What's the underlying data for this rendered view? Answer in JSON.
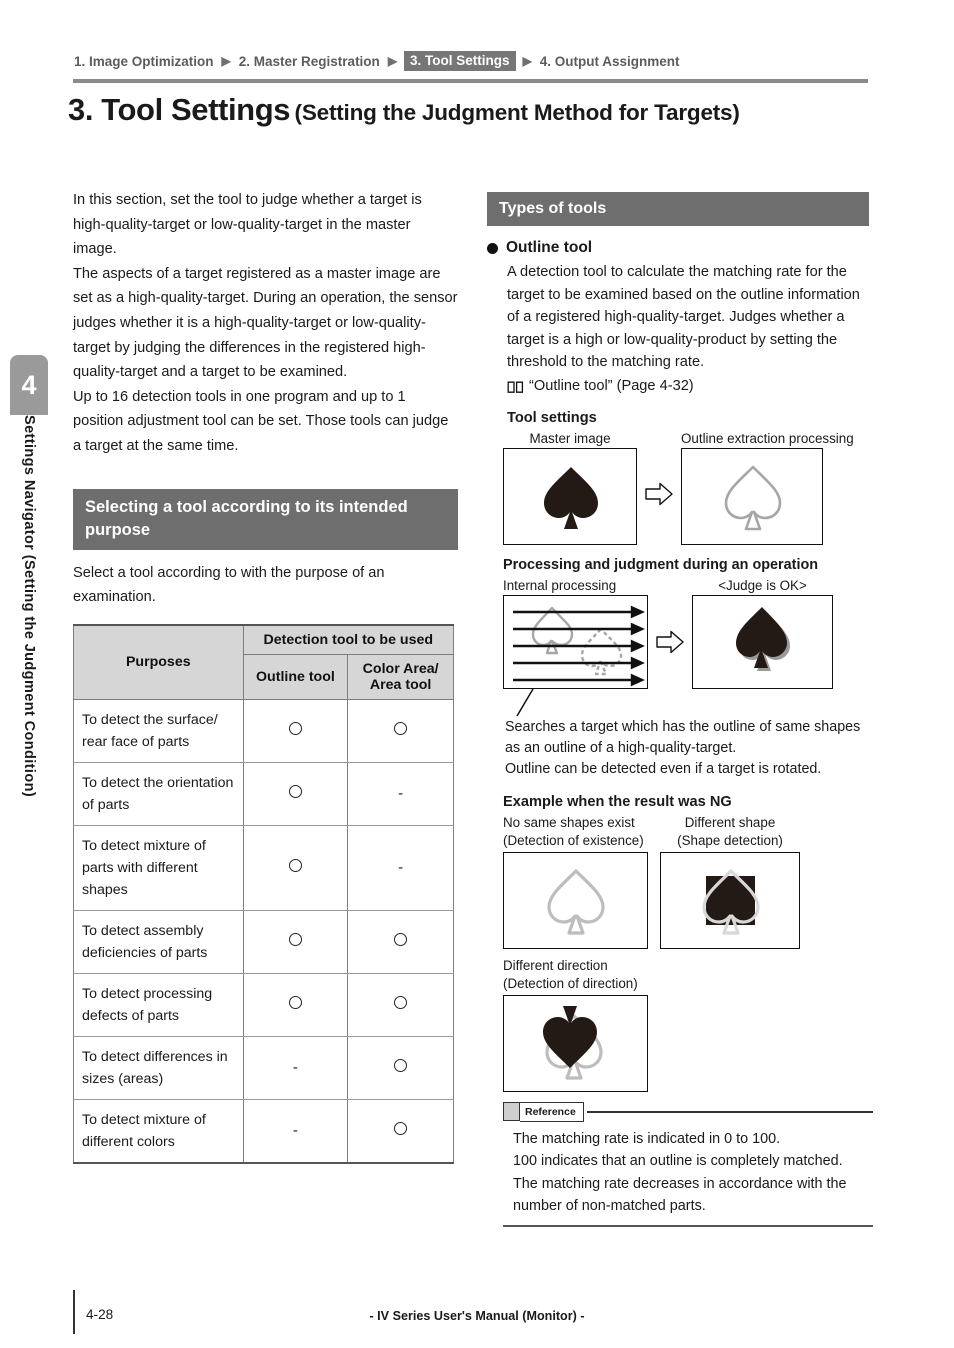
{
  "sidebar": {
    "chapter_number": "4",
    "chapter_label": "Settings Navigator (Setting the Judgment Condition)"
  },
  "breadcrumb": {
    "items": [
      {
        "label": "1. Image Optimization",
        "active": false
      },
      {
        "label": "2. Master Registration",
        "active": false
      },
      {
        "label": "3. Tool Settings",
        "active": true
      },
      {
        "label": "4. Output Assignment",
        "active": false
      }
    ],
    "separator_icon": "triangle-right-icon"
  },
  "title": {
    "main": "3. Tool Settings",
    "sub": "(Setting the Judgment Method for Targets)"
  },
  "left": {
    "intro": "In this section, set the tool to judge whether a target is high-quality-target or low-quality-target in the master image.\nThe aspects of a target registered as a master image are set as a high-quality-target. During an operation, the sensor judges whether it is a high-quality-target or low-quality-target by judging the differences in the registered high-quality-target and a target to be examined.\nUp to 16 detection tools in one program and up to 1 position adjustment tool can be set. Those tools can judge a target at the same time.",
    "section_heading": "Selecting a tool according to its intended purpose",
    "section_intro": "Select a tool according to with the purpose of an examination.",
    "table": {
      "col_purposes": "Purposes",
      "col_group": "Detection tool to be used",
      "col_outline": "Outline tool",
      "col_color": "Color Area/\nArea tool",
      "rows": [
        {
          "purpose": "To detect the surface/ rear face of parts",
          "outline": "circle",
          "color": "circle"
        },
        {
          "purpose": "To detect the orientation of parts",
          "outline": "circle",
          "color": "dash"
        },
        {
          "purpose": "To detect mixture of parts with different shapes",
          "outline": "circle",
          "color": "dash"
        },
        {
          "purpose": "To detect assembly deficiencies of parts",
          "outline": "circle",
          "color": "circle"
        },
        {
          "purpose": "To detect processing defects of parts",
          "outline": "circle",
          "color": "circle"
        },
        {
          "purpose": "To detect differences in sizes (areas)",
          "outline": "dash",
          "color": "circle"
        },
        {
          "purpose": "To detect mixture of different colors",
          "outline": "dash",
          "color": "circle"
        }
      ],
      "dash_glyph": "-"
    }
  },
  "right": {
    "section_heading": "Types of tools",
    "outline_tool": {
      "bullet_label": "Outline tool",
      "description": "A detection tool to calculate the matching rate for the target to be examined based on the outline information of a registered high-quality-target. Judges whether a target is a high or low-quality-product by setting the threshold to the matching rate.",
      "xref": "“Outline tool” (Page 4-32)",
      "xref_icon": "open-book-icon"
    },
    "tool_settings": {
      "heading": "Tool settings",
      "caption_left": "Master image",
      "caption_right": "Outline extraction processing",
      "arrow_icon": "block-arrow-right-icon"
    },
    "operation": {
      "heading": "Processing and judgment during an operation",
      "caption_left": "Internal processing",
      "caption_right": "<Judge is OK>",
      "arrow_icon": "block-arrow-right-icon",
      "note": "Searches a target which has the outline of same shapes as an outline of a high-quality-target.\nOutline can be detected even if a target is rotated."
    },
    "ng_examples": {
      "heading": "Example when the result was NG",
      "items": [
        {
          "title": "No same shapes exist",
          "subtitle": "(Detection of existence)",
          "figure": "gray-outline-spade"
        },
        {
          "title": "Different shape",
          "subtitle": "(Shape detection)",
          "figure": "black-square-over-spade"
        },
        {
          "title": "Different direction",
          "subtitle": "(Detection of direction)",
          "figure": "inverted-black-spade-over-outline"
        }
      ]
    },
    "reference": {
      "label": "Reference",
      "icon": "reference-square-icon",
      "text": "The matching rate is indicated in 0 to 100.\n100 indicates that an outline is completely matched.\nThe matching rate decreases in accordance with the number of non-matched parts."
    }
  },
  "footer": {
    "page_number": "4-28",
    "manual_title": "- IV Series User's Manual (Monitor) -"
  },
  "colors": {
    "accent_gray": "#6e6e6e",
    "breadcrumb_active": "#767676",
    "table_header": "#d6d6d6",
    "spade_black": "#231a16",
    "spade_gray": "#a6a6a6"
  }
}
